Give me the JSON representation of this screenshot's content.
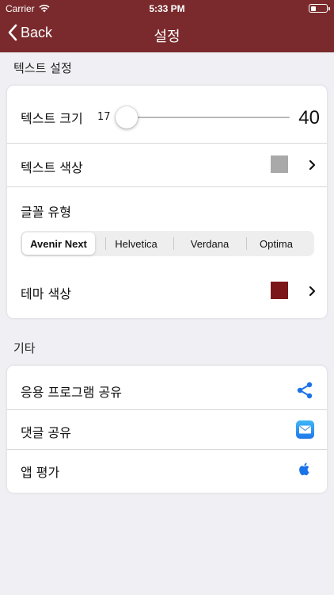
{
  "status": {
    "carrier": "Carrier",
    "time": "5:33 PM"
  },
  "nav": {
    "back_label": "Back",
    "title": "설정"
  },
  "text_settings": {
    "header": "텍스트 설정",
    "size": {
      "label": "텍스트 크기",
      "min": "17",
      "max": "40",
      "value": 17
    },
    "text_color": {
      "label": "텍스트 색상",
      "color": "#a9a9a9"
    },
    "font_type": {
      "label": "글꼴 유형",
      "options": [
        "Avenir Next",
        "Helvetica",
        "Verdana",
        "Optima"
      ],
      "selected": "Avenir Next"
    },
    "theme_color": {
      "label": "테마 색상",
      "color": "#7b171b"
    }
  },
  "other": {
    "header": "기타",
    "items": [
      {
        "label": "응용 프로그램 공유",
        "icon": "share-icon"
      },
      {
        "label": "댓글 공유",
        "icon": "mail-icon"
      },
      {
        "label": "앱 평가",
        "icon": "apple-icon"
      }
    ]
  },
  "colors": {
    "brand": "#7a2a2c",
    "accent_blue": "#1a73e8"
  }
}
